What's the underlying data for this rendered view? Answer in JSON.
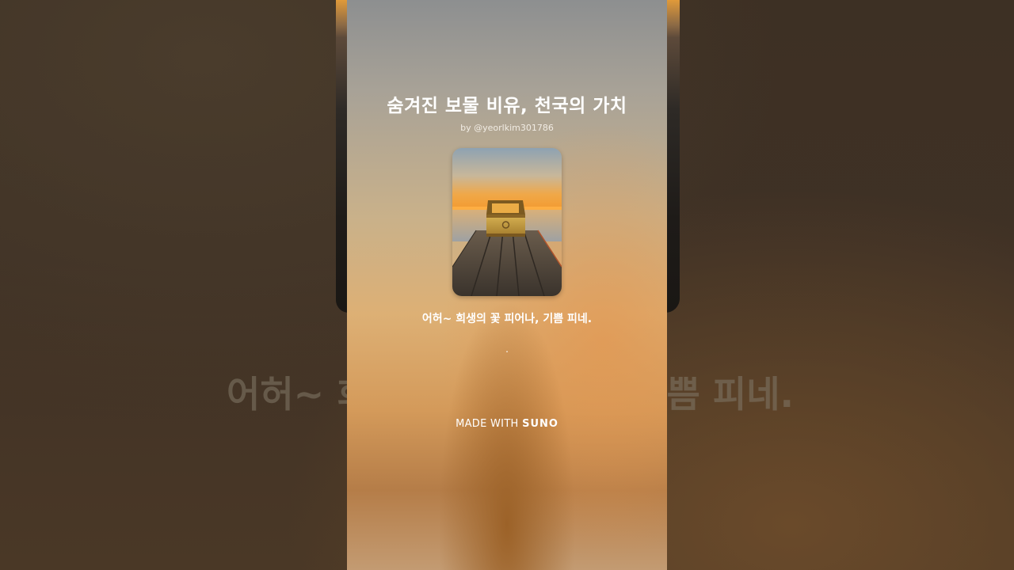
{
  "song": {
    "title": "숨겨진 보물 비유, 천국의 가치",
    "byline": "by @yeorlkim301786"
  },
  "cover_art": {
    "icon": "treasure-chest-on-pier-icon",
    "colors": {
      "sky_top": "#8fa3b3",
      "sunset": "#f2a03c",
      "water": "#b7b3a8",
      "pier": "#4d4438",
      "chest": "#c9a046"
    }
  },
  "lyrics": {
    "current_line": "어허~ 희생의 꽃 피어나, 기쁨 피네.",
    "next_line": "."
  },
  "footer": {
    "made_with_label": "MADE WITH",
    "brand": "SUNO"
  },
  "background": {
    "big_lyric_left": "어허~ 희",
    "big_lyric_right": "쁨 피네."
  }
}
